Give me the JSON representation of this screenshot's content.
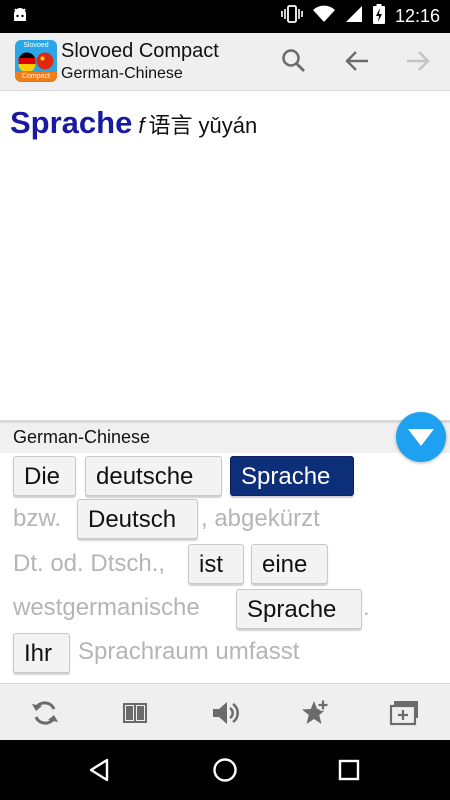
{
  "status_bar": {
    "time": "12:16"
  },
  "app_bar": {
    "logo_top": "Slovoed",
    "logo_bottom": "Compact",
    "title": "Slovoed Compact",
    "subtitle": "German-Chinese",
    "icons": [
      "search-icon",
      "back-arrow-icon",
      "forward-arrow-icon"
    ]
  },
  "entry": {
    "headword": "Sprache",
    "gender": "f",
    "translation": "语言",
    "pinyin": "yǔyán"
  },
  "panel": {
    "title": "German-Chinese"
  },
  "sentence": {
    "tokens": [
      {
        "text": "Die",
        "type": "word"
      },
      {
        "text": "deutsche",
        "type": "word"
      },
      {
        "text": "Sprache",
        "type": "word",
        "selected": true
      },
      {
        "text": "bzw.",
        "type": "plain"
      },
      {
        "text": "Deutsch",
        "type": "word"
      },
      {
        "text": ", abgekürzt",
        "type": "plain"
      },
      {
        "text": "Dt. od. Dtsch.,",
        "type": "plain"
      },
      {
        "text": "ist",
        "type": "word"
      },
      {
        "text": "eine",
        "type": "word"
      },
      {
        "text": "westgermanische",
        "type": "plain"
      },
      {
        "text": "Sprache",
        "type": "word"
      },
      {
        "text": ".",
        "type": "plain"
      },
      {
        "text": "Ihr",
        "type": "word"
      },
      {
        "text": "Sprachraum umfasst",
        "type": "plain"
      }
    ]
  },
  "bottom_bar": {
    "icons": [
      "refresh-icon",
      "book-icon",
      "speaker-icon",
      "add-favorite-icon",
      "add-card-icon"
    ]
  },
  "nav_bar": {
    "icons": [
      "back-triangle-icon",
      "home-circle-icon",
      "recents-square-icon"
    ]
  },
  "colors": {
    "headword": "#1a1aa0",
    "selected_word_bg": "#0d2e79",
    "fab": "#1ea1f0",
    "plain_text": "#b5b5b5"
  }
}
